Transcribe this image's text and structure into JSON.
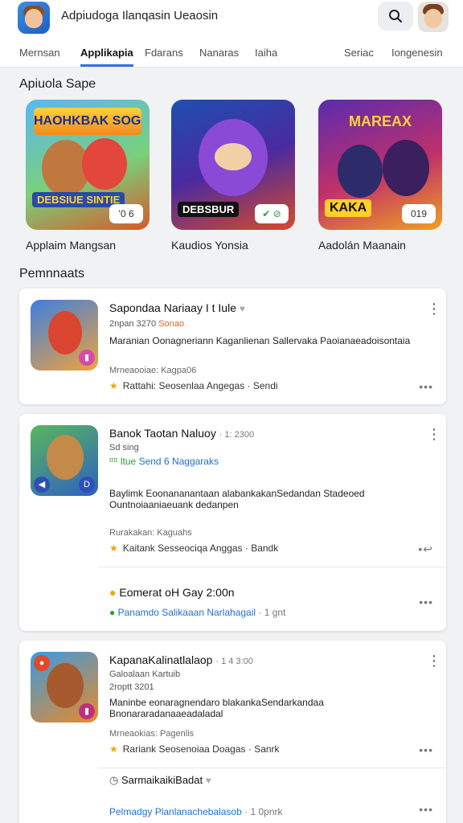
{
  "header": {
    "app_title": "Adpiudoga Ilanqasin Ueaosin",
    "search_icon": "search-icon",
    "avatar_icon": "avatar"
  },
  "tabs": [
    {
      "label": "Mernsan",
      "active": false
    },
    {
      "label": "Applikapia",
      "active": true
    },
    {
      "label": "Fdarans",
      "active": false
    },
    {
      "label": "Nanaras",
      "active": false
    },
    {
      "label": "Iaiha",
      "active": false
    },
    {
      "label": "Seriac",
      "active": false
    },
    {
      "label": "Iongenesin",
      "active": false
    }
  ],
  "featured": {
    "section_title": "Apiuola Sape",
    "items": [
      {
        "banner": "HAOHKBAK SOGIUS",
        "tag": "DEBSIUE SINTIE",
        "badge": "ʻ0 6",
        "caption": "Applaim Mangsan"
      },
      {
        "banner": "",
        "tag": "DEBSBUR",
        "badge": "✔ ⊘",
        "caption": "Kaudios Yonsia"
      },
      {
        "banner": "MAREAX",
        "tag": "KAKA",
        "badge": "019",
        "caption": "Aadolán Maanain"
      }
    ]
  },
  "list": {
    "section_title": "Pemnnaats",
    "cards": [
      {
        "title": "Sapondaa Nariaay I t Iule",
        "sub_a": "2npan 3270",
        "sub_b": "Sonao",
        "desc": "Maranian Oonagneriann Kaganlienan Sallervaka Paoianaeadoisontaia",
        "meta": "Mrneaooiae: Kagpa06",
        "rating": "Rattahi: Seosenlaa  Angegas · Sendi",
        "dots": "•••"
      },
      {
        "title": "Banok Taotan Naluoy",
        "title_suffix": "· 1: 2300",
        "sub_a": "Sd sing",
        "sub_b": "Send 6 Naggaraks",
        "sub_b_prefix": "ᵗᵗᵗᵗ ltue",
        "desc": "Baylimk Eoonananantaan alabankakanSedandan Stadeoed Ountnoiaaniaeuank dedanpen",
        "meta": "Rurakakan: Kaguahs",
        "rating": "Kaitank Sesseociqa  Anggas · Bandk",
        "dots": "•↩",
        "event_title": "Eomerat oH Gay 2:00n",
        "event_link": "Panamdo Salikaaan Narlahagail",
        "event_link_suffix": "· 1 gnt",
        "event_dots": "•••"
      },
      {
        "title": "KapanaKalinatlalaop",
        "title_suffix": "· 1 4 3:00",
        "sub_a": "Galoalaan Kartuib",
        "sub_b": "2roptt 3201",
        "desc": "Maninbe eonaragnendaro blakankaSendarkandaa Bnonararadanaaeadaladal",
        "meta": "Mrneaokias: Pagenlis",
        "rating": "Rariank Seosenoiaa  Doagas · Sanrk",
        "dots": "•••",
        "event_title": "SarmaikaikiBadat",
        "event_link": "Pelmadgy Planlanachebalasob",
        "event_link_suffix": "· 1 0pnrk",
        "event_dots": "•••"
      }
    ]
  },
  "colors": {
    "accent": "#2f6fe0",
    "orange": "#e0641c",
    "star": "#f2a400"
  }
}
